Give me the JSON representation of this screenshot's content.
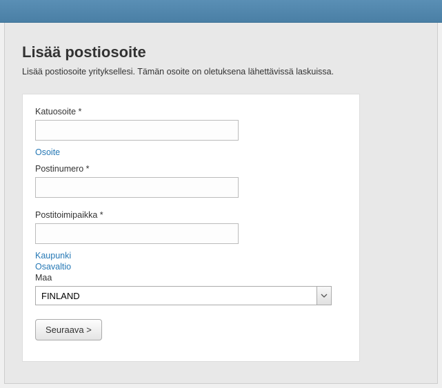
{
  "page": {
    "title": "Lisää postiosoite",
    "subtitle": "Lisää postiosoite yrityksellesi. Tämän osoite on oletuksena lähettävissä laskuissa."
  },
  "form": {
    "street_label": "Katuosoite *",
    "street_value": "",
    "address_link": "Osoite",
    "postal_label": "Postinumero *",
    "postal_value": "",
    "city_label": "Postitoimipaikka *",
    "city_value": "",
    "city_link": "Kaupunki",
    "state_link": "Osavaltio",
    "country_label": "Maa",
    "country_value": "FINLAND",
    "submit_label": "Seuraava >"
  }
}
